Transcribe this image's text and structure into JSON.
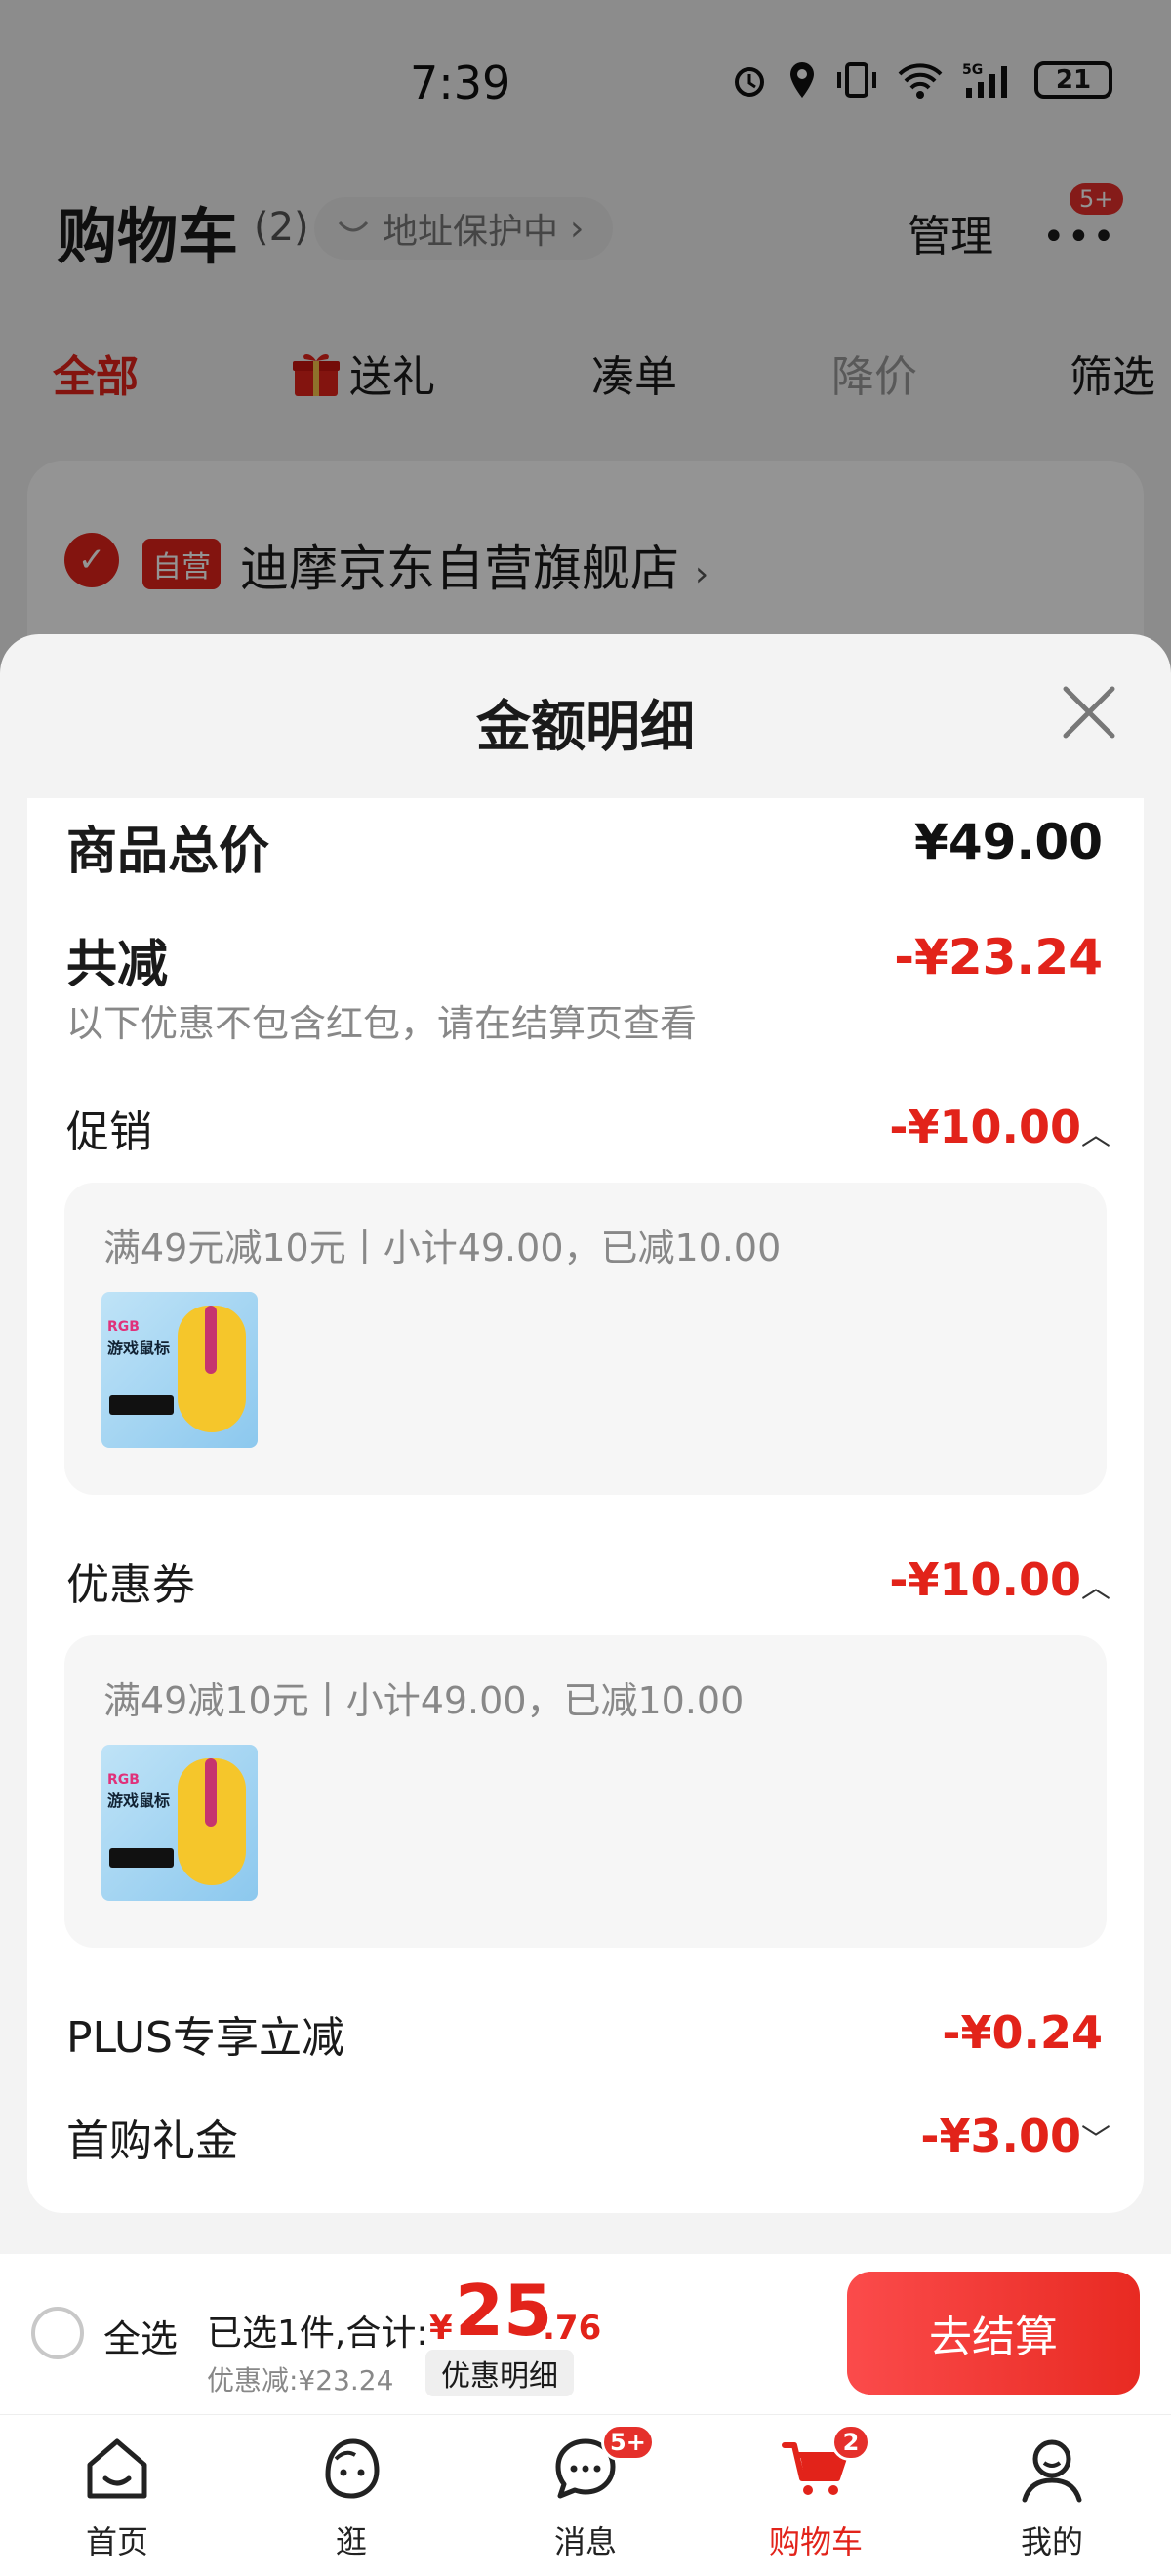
{
  "status_bar": {
    "time": "7:39",
    "battery": "21",
    "network": "5G"
  },
  "header": {
    "title": "购物车",
    "count": "(2)",
    "address_protection": "地址保护中",
    "manage": "管理",
    "more_badge": "5+"
  },
  "tabs": [
    "全部",
    "送礼",
    "凑单",
    "降价",
    "筛选"
  ],
  "store": {
    "tag": "自营",
    "name": "迪摩京东自营旗舰店"
  },
  "sheet": {
    "title": "金额明细",
    "total_label": "商品总价",
    "total_value": "¥49.00",
    "discount_label": "共减",
    "discount_value": "-¥23.24",
    "note": "以下优惠不包含红包，请在结算页查看",
    "promo": {
      "label": "促销",
      "value": "-¥10.00",
      "detail": "满49元减10元丨小计49.00，已减10.00"
    },
    "coupon": {
      "label": "优惠券",
      "value": "-¥10.00",
      "detail": "满49减10元丨小计49.00，已减10.00"
    },
    "plus": {
      "label": "PLUS专享立减",
      "value": "-¥0.24"
    },
    "first_gift": {
      "label": "首购礼金",
      "value": "-¥3.00"
    },
    "product_thumb": {
      "line1": "RGB",
      "line2": "游戏鼠标"
    }
  },
  "checkout": {
    "select_all": "全选",
    "summary": "已选1件,合计:",
    "currency": "¥",
    "total_int": "25",
    "total_dec": ".76",
    "saved": "优惠减:¥23.24",
    "detail_button": "优惠明细",
    "checkout_button": "去结算"
  },
  "tabbar": [
    {
      "label": "首页"
    },
    {
      "label": "逛"
    },
    {
      "label": "消息",
      "badge": "5+"
    },
    {
      "label": "购物车",
      "badge": "2"
    },
    {
      "label": "我的"
    }
  ],
  "colors": {
    "accent": "#e2231a",
    "sheet_bg": "#f3f3f3",
    "card_bg": "#ffffff"
  }
}
